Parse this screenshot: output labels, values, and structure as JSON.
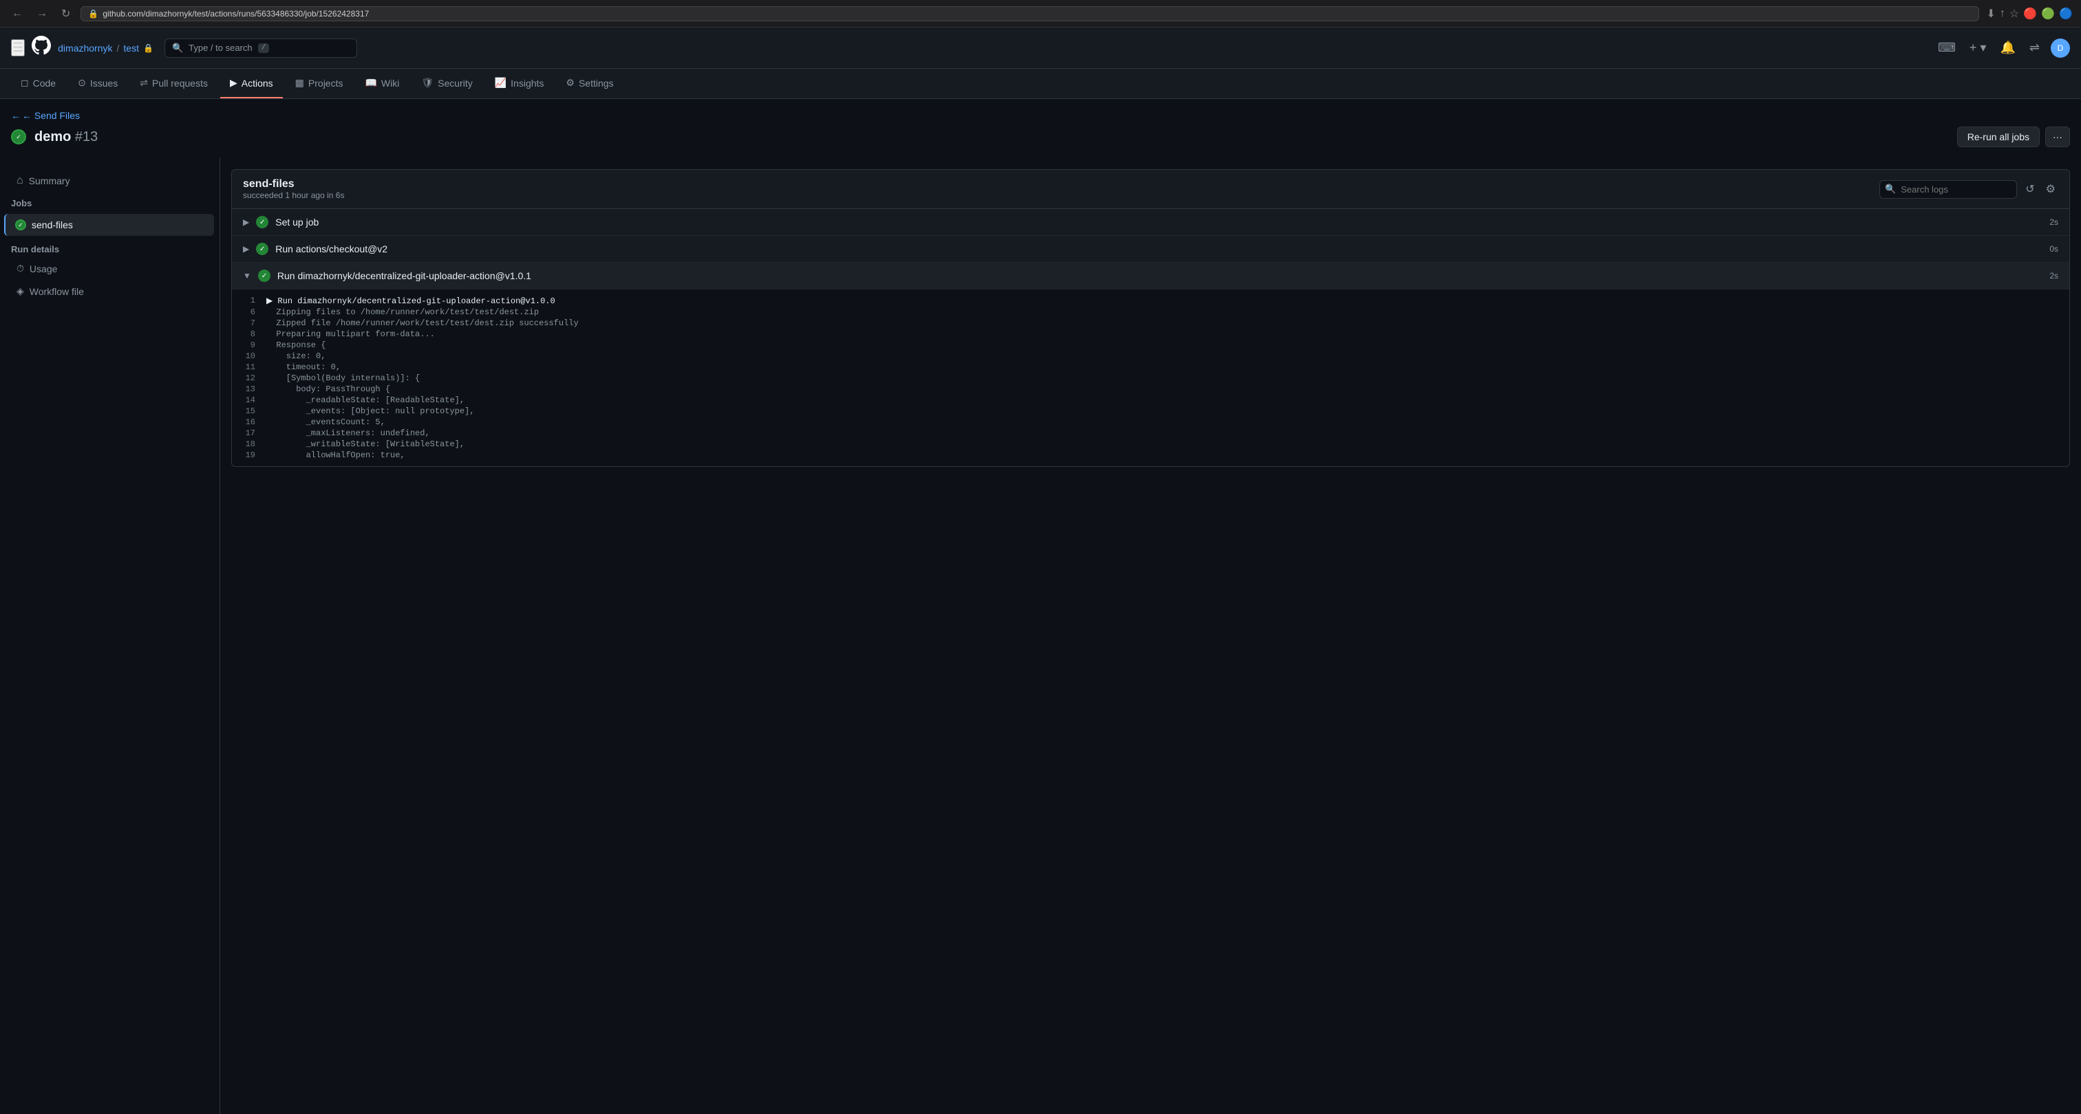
{
  "browser": {
    "url": "github.com/dimazhornyk/test/actions/runs/5633486330/job/15262428317",
    "back": "←",
    "forward": "→",
    "reload": "↻"
  },
  "header": {
    "hamburger": "☰",
    "logo": "⬤",
    "owner": "dimazhornyk",
    "sep": "/",
    "repo": "test",
    "lock": "🔒",
    "search_placeholder": "Type / to search",
    "search_shortcut": "/",
    "plus_label": "+",
    "notifications_label": "🔔",
    "avatar_label": "D"
  },
  "repo_nav": {
    "items": [
      {
        "id": "code",
        "icon": "◻",
        "label": "Code"
      },
      {
        "id": "issues",
        "icon": "⊙",
        "label": "Issues"
      },
      {
        "id": "pulls",
        "icon": "⇌",
        "label": "Pull requests"
      },
      {
        "id": "actions",
        "icon": "▶",
        "label": "Actions",
        "active": true
      },
      {
        "id": "projects",
        "icon": "▦",
        "label": "Projects"
      },
      {
        "id": "wiki",
        "icon": "📖",
        "label": "Wiki"
      },
      {
        "id": "security",
        "icon": "🛡",
        "label": "Security"
      },
      {
        "id": "insights",
        "icon": "📈",
        "label": "Insights"
      },
      {
        "id": "settings",
        "icon": "⚙",
        "label": "Settings"
      }
    ]
  },
  "workflow": {
    "back_label": "← Send Files",
    "title": "demo",
    "run_number": "#13",
    "rerun_label": "Re-run all jobs",
    "more_label": "···"
  },
  "sidebar": {
    "summary_label": "Summary",
    "jobs_header": "Jobs",
    "jobs": [
      {
        "id": "send-files",
        "label": "send-files",
        "active": true,
        "status": "success"
      }
    ],
    "run_details_header": "Run details",
    "run_details": [
      {
        "id": "usage",
        "icon": "⏱",
        "label": "Usage"
      },
      {
        "id": "workflow-file",
        "icon": "◈",
        "label": "Workflow file"
      }
    ]
  },
  "job_panel": {
    "title": "send-files",
    "subtitle": "succeeded 1 hour ago in 6s",
    "search_placeholder": "Search logs",
    "steps": [
      {
        "id": "set-up-job",
        "label": "Set up job",
        "status": "success",
        "expanded": false,
        "duration": "2s"
      },
      {
        "id": "run-checkout",
        "label": "Run actions/checkout@v2",
        "status": "success",
        "expanded": false,
        "duration": "0s"
      },
      {
        "id": "run-action",
        "label": "Run dimazhornyk/decentralized-git-uploader-action@v1.0.1",
        "status": "success",
        "expanded": true,
        "duration": "2s"
      }
    ],
    "log_lines": [
      {
        "num": "1",
        "content": "▶ Run dimazhornyk/decentralized-git-uploader-action@v1.0.0",
        "highlight": true
      },
      {
        "num": "6",
        "content": "  Zipping files to /home/runner/work/test/test/dest.zip",
        "highlight": false
      },
      {
        "num": "7",
        "content": "  Zipped file /home/runner/work/test/test/dest.zip successfully",
        "highlight": false
      },
      {
        "num": "8",
        "content": "  Preparing multipart form-data...",
        "highlight": false
      },
      {
        "num": "9",
        "content": "  Response {",
        "highlight": false
      },
      {
        "num": "10",
        "content": "    size: 0,",
        "highlight": false
      },
      {
        "num": "11",
        "content": "    timeout: 0,",
        "highlight": false
      },
      {
        "num": "12",
        "content": "    [Symbol(Body internals)]: {",
        "highlight": false
      },
      {
        "num": "13",
        "content": "      body: PassThrough {",
        "highlight": false
      },
      {
        "num": "14",
        "content": "        _readableState: [ReadableState],",
        "highlight": false
      },
      {
        "num": "15",
        "content": "        _events: [Object: null prototype],",
        "highlight": false
      },
      {
        "num": "16",
        "content": "        _eventsCount: 5,",
        "highlight": false
      },
      {
        "num": "17",
        "content": "        _maxListeners: undefined,",
        "highlight": false
      },
      {
        "num": "18",
        "content": "        _writableState: [WritableState],",
        "highlight": false
      },
      {
        "num": "19",
        "content": "        allowHalfOpen: true,",
        "highlight": false
      }
    ]
  }
}
